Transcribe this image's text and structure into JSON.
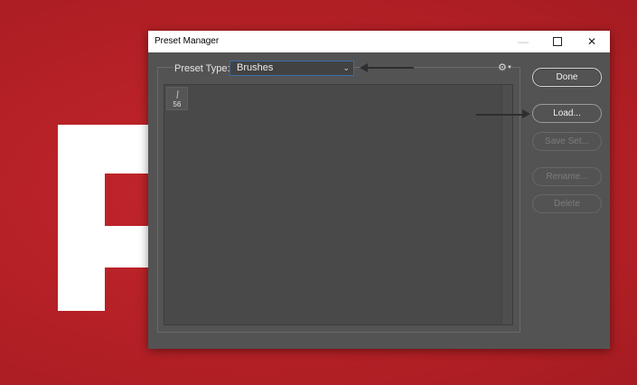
{
  "window": {
    "title": "Preset Manager",
    "minimize_icon": "minimize-icon",
    "maximize_icon": "maximize-icon",
    "close_icon": "close-icon"
  },
  "preset": {
    "label": "Preset Type:",
    "selected": "Brushes"
  },
  "preset_list": {
    "items": [
      {
        "size": "56"
      }
    ]
  },
  "buttons": {
    "done": "Done",
    "load": "Load...",
    "save_set": "Save Set...",
    "rename": "Rename...",
    "delete": "Delete"
  },
  "colors": {
    "background_red": "#b52126",
    "dialog_gray": "#535353",
    "select_border": "#3a6ea5"
  }
}
